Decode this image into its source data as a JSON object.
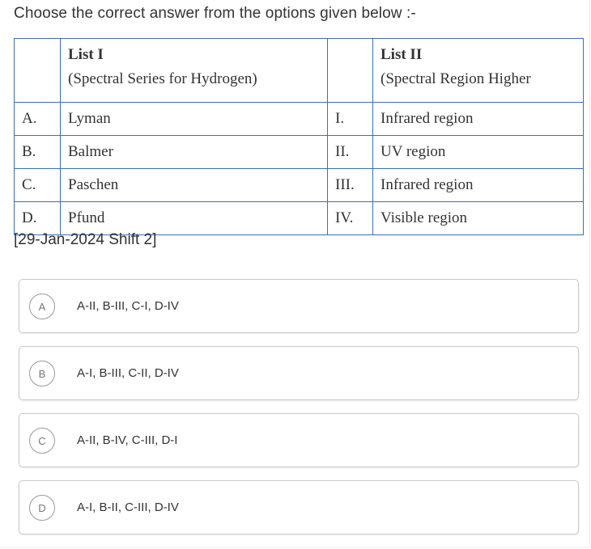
{
  "question": "Choose the correct answer from the options given below :-",
  "table": {
    "header": {
      "list1_title": "List I",
      "list1_sub": "(Spectral Series for Hydrogen)",
      "list2_title": "List II",
      "list2_sub": "(Spectral Region Higher"
    },
    "rows": [
      {
        "a": "A.",
        "b": "Lyman",
        "c": "I.",
        "d": "Infrared region"
      },
      {
        "a": "B.",
        "b": "Balmer",
        "c": "II.",
        "d": "UV region"
      },
      {
        "a": "C.",
        "b": "Paschen",
        "c": "III.",
        "d": "Infrared region"
      },
      {
        "a": "D.",
        "b": "Pfund",
        "c": "IV.",
        "d": "Visible region"
      }
    ]
  },
  "source": "[29-Jan-2024 Shift 2]",
  "options": [
    {
      "letter": "A",
      "text": "A-II, B-III, C-I, D-IV"
    },
    {
      "letter": "B",
      "text": "A-I, B-III, C-II, D-IV"
    },
    {
      "letter": "C",
      "text": "A-II, B-IV, C-III, D-I"
    },
    {
      "letter": "D",
      "text": "A-I, B-II, C-III, D-IV"
    }
  ]
}
